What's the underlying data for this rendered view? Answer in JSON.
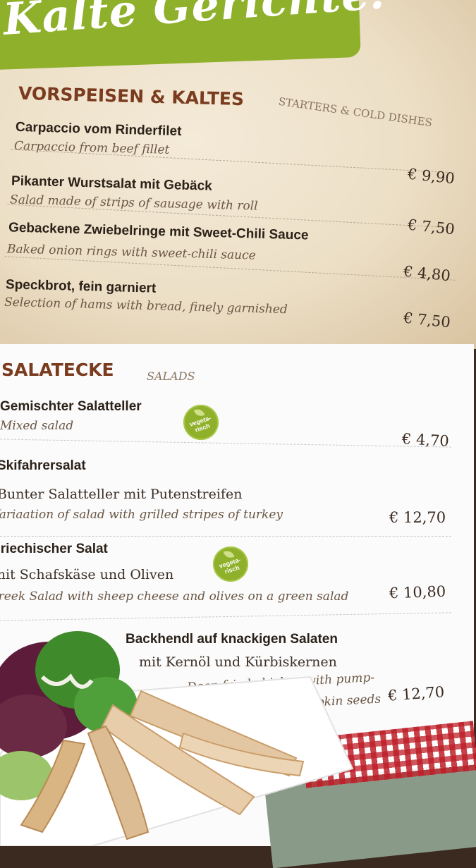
{
  "title": "Kalte Gerichte:",
  "starters": {
    "heading": "VORSPEISEN & KALTES",
    "subheading": "STARTERS & COLD DISHES",
    "items": [
      {
        "name": "Carpaccio vom Rinderfilet",
        "desc": "Carpaccio from beef fillet",
        "price": "€ 9,90"
      },
      {
        "name": "Pikanter Wurstsalat mit Gebäck",
        "desc": "Salad made of strips of sausage with roll",
        "price": "€ 7,50"
      },
      {
        "name": "Gebackene Zwiebelringe mit Sweet-Chili Sauce",
        "desc": "Baked onion rings with sweet-chili sauce",
        "price": "€ 4,80"
      },
      {
        "name": "Speckbrot, fein garniert",
        "desc": "Selection of hams with bread, finely garnished",
        "price": "€ 7,50"
      }
    ]
  },
  "salads": {
    "heading": "SALATECKE",
    "subheading": "SALADS",
    "badge": "vegeta-risch",
    "items": [
      {
        "name": "Gemischter Salatteller",
        "desc": "Mixed salad",
        "price": "€ 4,70"
      },
      {
        "name": "Skifahrersalat",
        "desc_de": "Bunter Salatteller mit Putenstreifen",
        "desc": "Variaation of salad with grilled stripes of turkey",
        "price": "€ 12,70"
      },
      {
        "name": "Griechischer Salat",
        "desc_de": "mit Schafskäse und Oliven",
        "desc": "Greek Salad with sheep cheese and olives on a green salad",
        "price": "€ 10,80"
      },
      {
        "name": "Backhendl auf knackigen Salaten",
        "desc_de": "mit Kernöl und Kürbiskernen",
        "desc": "Deep fried chicken with pump-",
        "desc_b": "kinseed oil & pumpkin seeds",
        "price": "€ 12,70"
      }
    ]
  },
  "colors": {
    "accent_green": "#8fb02a",
    "heading_brown": "#7a3b1e"
  }
}
